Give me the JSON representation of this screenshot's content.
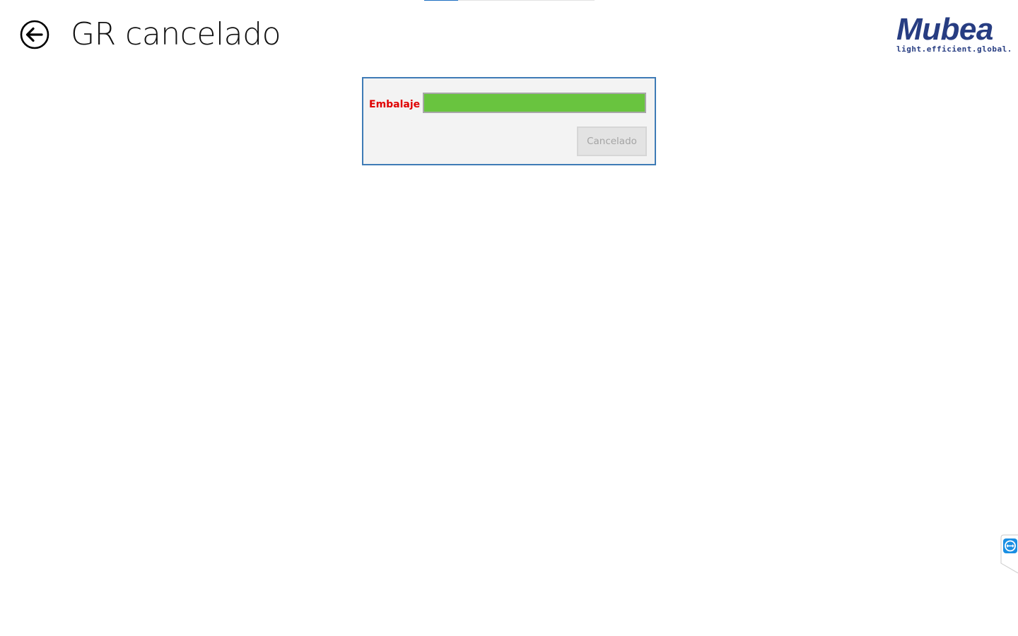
{
  "top_progress": {
    "value": 0.2,
    "fill_color": "#1e6fc2"
  },
  "header": {
    "back_icon": "back-arrow-circle-icon",
    "title": "GR cancelado"
  },
  "logo": {
    "name": "Mubea",
    "tagline": "light.efficient.global.",
    "color": "#273d82"
  },
  "form": {
    "field_label": "Embalaje",
    "field_label_color": "#e00000",
    "field_value": "",
    "field_background": "#69c43f",
    "border_color": "#3e7bb6",
    "button_label": "Cancelado",
    "button_enabled": false
  },
  "side_tab": {
    "icon": "teamviewer-icon",
    "color": "#1a8fe3"
  }
}
